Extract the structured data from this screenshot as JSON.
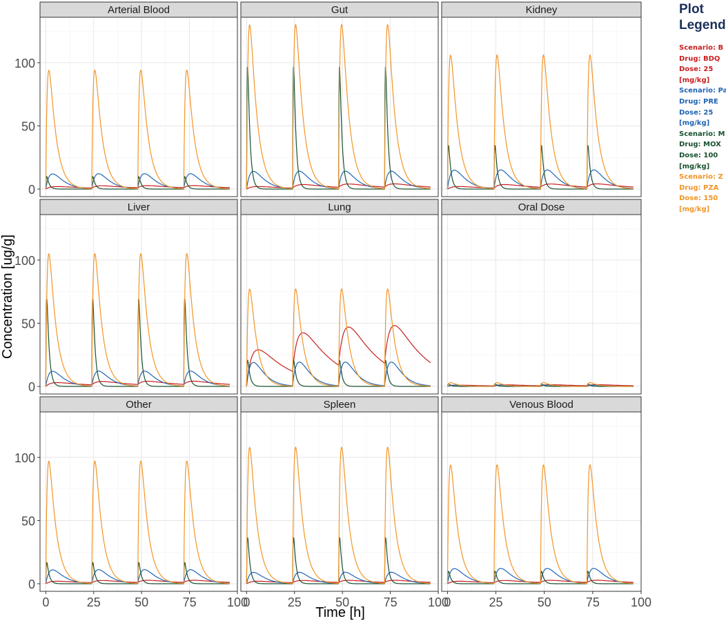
{
  "chart_data": {
    "type": "line",
    "xlabel": "Time [h]",
    "ylabel": "Concentration [ug/g]",
    "x_ticks": [
      0,
      25,
      50,
      75,
      100
    ],
    "x_tick_labels": [
      "0",
      "25",
      "50",
      "75",
      "100"
    ],
    "y_ticks": [
      0,
      50,
      100
    ],
    "y_tick_labels": [
      "0",
      "50",
      "100"
    ],
    "xlim": [
      -3,
      100
    ],
    "ylim": [
      -6,
      136
    ],
    "grid": true,
    "dose_times_h": [
      0,
      24,
      48,
      72
    ],
    "legend": {
      "title": "Plot Legend:",
      "position": "right",
      "entries": [
        {
          "lines": [
            "Scenario: B",
            "Drug: BDQ",
            "Dose: 25",
            "[mg/kg]"
          ],
          "color": "#c81e1e"
        },
        {
          "lines": [
            "Scenario: Pa",
            "Drug: PRE",
            "Dose: 25",
            "[mg/kg]"
          ],
          "color": "#1f64b3"
        },
        {
          "lines": [
            "Scenario: M",
            "Drug: MOX",
            "Dose: 100",
            "[mg/kg]"
          ],
          "color": "#17502f"
        },
        {
          "lines": [
            "Scenario: Z",
            "Drug: PZA",
            "Dose: 150",
            "[mg/kg]"
          ],
          "color": "#f29426"
        }
      ]
    },
    "series_colors": {
      "BDQ": "#c81e1e",
      "PRE": "#1f64b3",
      "MOX": "#17502f",
      "PZA": "#f29426"
    },
    "panels": [
      {
        "title": "Arterial Blood",
        "peaks_per_dose": {
          "PZA": [
            94,
            94,
            94,
            94
          ],
          "MOX": [
            10,
            10,
            10,
            10
          ],
          "PRE": [
            12,
            12,
            12,
            12
          ],
          "BDQ": [
            2,
            2,
            2,
            2
          ]
        }
      },
      {
        "title": "Gut",
        "peaks_per_dose": {
          "PZA": [
            130,
            130,
            130,
            130
          ],
          "MOX": [
            98,
            98,
            98,
            98
          ],
          "PRE": [
            14,
            14,
            14,
            14
          ],
          "BDQ": [
            2,
            3,
            3,
            3
          ]
        }
      },
      {
        "title": "Kidney",
        "peaks_per_dose": {
          "PZA": [
            106,
            106,
            106,
            106
          ],
          "MOX": [
            35,
            35,
            35,
            35
          ],
          "PRE": [
            15,
            15,
            15,
            15
          ],
          "BDQ": [
            2,
            3,
            3,
            3
          ]
        }
      },
      {
        "title": "Liver",
        "peaks_per_dose": {
          "PZA": [
            105,
            105,
            105,
            105
          ],
          "MOX": [
            70,
            70,
            70,
            70
          ],
          "PRE": [
            12,
            12,
            12,
            12
          ],
          "BDQ": [
            3,
            3,
            3,
            3
          ]
        }
      },
      {
        "title": "Lung",
        "peaks_per_dose": {
          "PZA": [
            77,
            77,
            77,
            77
          ],
          "MOX": [
            21,
            21,
            21,
            21
          ],
          "PRE": [
            19,
            19,
            19,
            19
          ],
          "BDQ": [
            29,
            34,
            35,
            35
          ]
        }
      },
      {
        "title": "Oral Dose",
        "peaks_per_dose": {
          "PZA": [
            3,
            3,
            3,
            3
          ],
          "MOX": [
            2,
            2,
            2,
            2
          ],
          "PRE": [
            1,
            1,
            1,
            1
          ],
          "BDQ": [
            1,
            1,
            1,
            1
          ]
        }
      },
      {
        "title": "Other",
        "peaks_per_dose": {
          "PZA": [
            97,
            97,
            97,
            97
          ],
          "MOX": [
            17,
            17,
            17,
            17
          ],
          "PRE": [
            11,
            11,
            11,
            11
          ],
          "BDQ": [
            2,
            2,
            2,
            2
          ]
        }
      },
      {
        "title": "Spleen",
        "peaks_per_dose": {
          "PZA": [
            108,
            108,
            108,
            108
          ],
          "MOX": [
            37,
            37,
            37,
            37
          ],
          "PRE": [
            9,
            9,
            9,
            9
          ],
          "BDQ": [
            2,
            2,
            2,
            2
          ]
        }
      },
      {
        "title": "Venous Blood",
        "peaks_per_dose": {
          "PZA": [
            94,
            94,
            94,
            94
          ],
          "MOX": [
            10,
            10,
            10,
            10
          ],
          "PRE": [
            12,
            12,
            12,
            12
          ],
          "BDQ": [
            2,
            2,
            2,
            2
          ]
        }
      }
    ]
  }
}
